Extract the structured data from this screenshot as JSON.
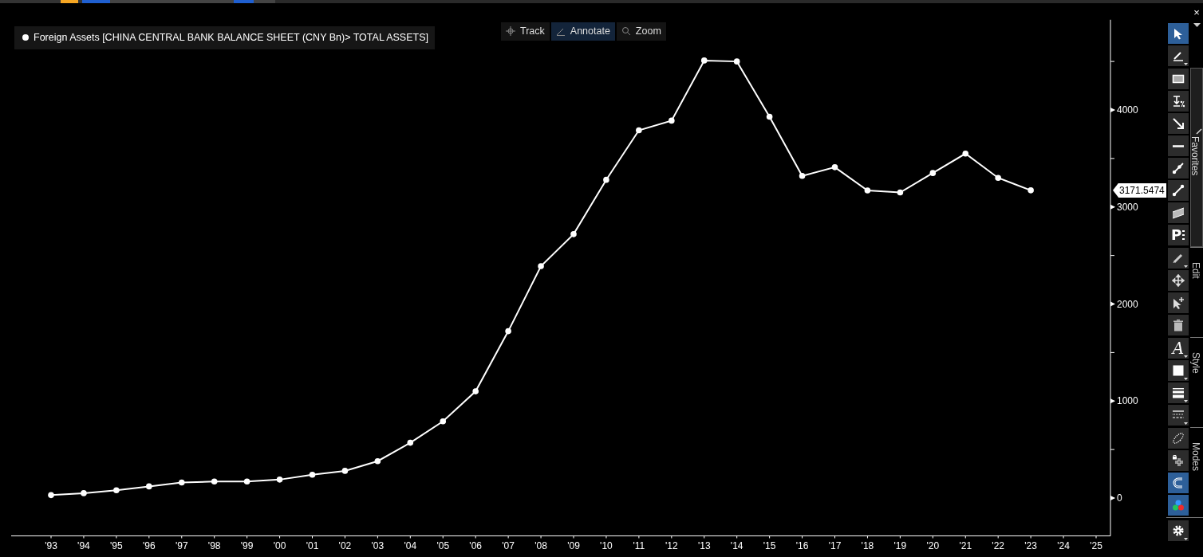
{
  "window": {
    "close": "×"
  },
  "modes": [
    {
      "label": "Track",
      "kind": "crosshair",
      "selected": false
    },
    {
      "label": "Annotate",
      "kind": "pen",
      "selected": true
    },
    {
      "label": "Zoom",
      "kind": "magnifier",
      "selected": false
    }
  ],
  "chart": {
    "last_value": "3171.5474",
    "chart_data": {
      "type": "line",
      "categories": [
        "'93",
        "'94",
        "'95",
        "'96",
        "'97",
        "'98",
        "'99",
        "'00",
        "'01",
        "'02",
        "'03",
        "'04",
        "'05",
        "'06",
        "'07",
        "'08",
        "'09",
        "'10",
        "'11",
        "'12",
        "'13",
        "'14",
        "'15",
        "'16",
        "'17",
        "'18",
        "'19",
        "'20",
        "'21",
        "'22",
        "'23",
        "'24",
        "'25"
      ],
      "series": [
        {
          "name": "Foreign Assets [CHINA CENTRAL BANK BALANCE SHEET (CNY Bn)> TOTAL ASSETS]",
          "color": "#ffffff",
          "marker": "circle",
          "values": [
            30,
            50,
            80,
            120,
            160,
            170,
            170,
            190,
            240,
            280,
            380,
            570,
            790,
            1100,
            1720,
            2390,
            2720,
            3280,
            3790,
            3890,
            4510,
            4500,
            3930,
            3320,
            3410,
            3170,
            3150,
            3350,
            3550,
            3300,
            3171.5474,
            null,
            null
          ]
        }
      ],
      "ylim": [
        -390,
        4930
      ],
      "yticks": [
        0,
        1000,
        2000,
        3000,
        4000
      ]
    }
  },
  "toolbar": {
    "top_tools": [
      {
        "kind": "pointer",
        "selected": true,
        "menu": false
      },
      {
        "kind": "pen-line",
        "selected": false,
        "menu": true
      }
    ],
    "groups": [
      {
        "label": "Favorites",
        "selected": true,
        "tools": [
          {
            "kind": "rectangle",
            "selected": false,
            "menu": false
          },
          {
            "kind": "level-percent",
            "selected": false,
            "menu": false
          },
          {
            "kind": "arrow",
            "selected": false,
            "menu": false
          },
          {
            "kind": "hline",
            "selected": false,
            "menu": false
          },
          {
            "kind": "segment",
            "selected": false,
            "menu": false
          },
          {
            "kind": "segment-ends",
            "selected": false,
            "menu": false
          },
          {
            "kind": "channel",
            "selected": false,
            "menu": false
          },
          {
            "kind": "glyph-list",
            "glyph": "P",
            "selected": false,
            "menu": false
          }
        ]
      },
      {
        "label": "Edit",
        "selected": false,
        "tools": [
          {
            "kind": "pencil",
            "selected": false,
            "menu": true
          },
          {
            "kind": "move",
            "selected": false,
            "menu": false
          },
          {
            "kind": "add-pointer",
            "selected": false,
            "menu": false
          },
          {
            "kind": "trash",
            "selected": false,
            "menu": false
          }
        ]
      },
      {
        "label": "Style",
        "selected": false,
        "tools": [
          {
            "kind": "glyph",
            "glyph": "A",
            "selected": false,
            "menu": true
          },
          {
            "kind": "fill",
            "selected": false,
            "menu": true
          },
          {
            "kind": "line-width",
            "selected": false,
            "menu": true
          },
          {
            "kind": "dash",
            "selected": false,
            "menu": true
          }
        ]
      },
      {
        "label": "Modes",
        "selected": false,
        "tools": [
          {
            "kind": "lasso",
            "selected": false,
            "menu": false
          },
          {
            "kind": "crosshair-lock",
            "selected": false,
            "menu": false
          },
          {
            "kind": "magnet",
            "selected": true,
            "menu": false
          },
          {
            "kind": "colors",
            "selected": true,
            "menu": false
          }
        ]
      }
    ],
    "bottom_tools": [
      {
        "kind": "gear",
        "selected": false,
        "menu": true
      }
    ]
  }
}
